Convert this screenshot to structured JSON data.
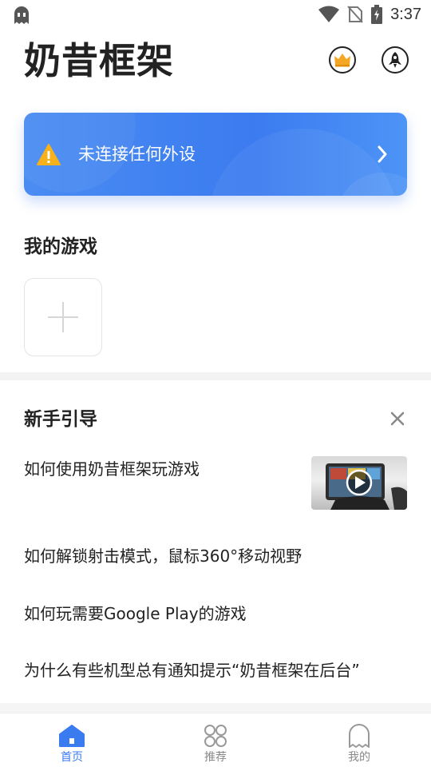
{
  "status_bar": {
    "time": "3:37",
    "icons": [
      "ghost-app-icon",
      "wifi-icon",
      "no-sim-icon",
      "battery-charging-icon"
    ]
  },
  "header": {
    "title": "奶昔框架",
    "buttons": [
      "crown-icon",
      "rocket-icon"
    ]
  },
  "banner": {
    "text": "未连接任何外设",
    "icon": "warning-icon",
    "color": "#3b7bf0"
  },
  "my_games": {
    "title": "我的游戏",
    "add_icon": "plus-icon"
  },
  "guide": {
    "title": "新手引导",
    "items": [
      {
        "label": "如何使用奶昔框架玩游戏"
      },
      {
        "label": "如何解锁射击模式，鼠标360°移动视野"
      },
      {
        "label": "如何玩需要Google Play的游戏"
      },
      {
        "label": "为什么有些机型总有通知提示“奶昔框架在后台”"
      }
    ]
  },
  "bottom_nav": {
    "items": [
      {
        "label": "首页",
        "icon": "home-icon",
        "active": true
      },
      {
        "label": "推荐",
        "icon": "recommend-icon",
        "active": false
      },
      {
        "label": "我的",
        "icon": "profile-ghost-icon",
        "active": false
      }
    ],
    "accent": "#3b7bf0"
  }
}
